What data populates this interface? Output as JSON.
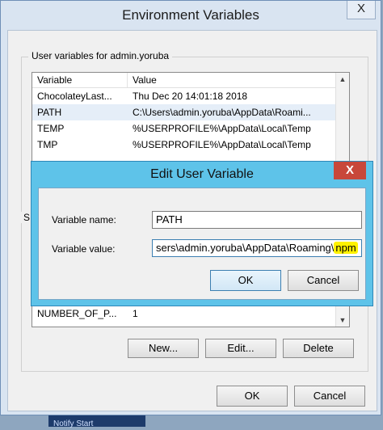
{
  "background": {
    "strip_text": "Notify  Start"
  },
  "outer": {
    "title": "Environment Variables",
    "close_glyph": "X",
    "user_group_label": "User variables for admin.yoruba",
    "columns": [
      "Variable",
      "Value"
    ],
    "user_rows": [
      {
        "variable": "ChocolateyLast...",
        "value": "Thu Dec 20 14:01:18 2018"
      },
      {
        "variable": "PATH",
        "value": "C:\\Users\\admin.yoruba\\AppData\\Roami..."
      },
      {
        "variable": "TEMP",
        "value": "%USERPROFILE%\\AppData\\Local\\Temp"
      },
      {
        "variable": "TMP",
        "value": "%USERPROFILE%\\AppData\\Local\\Temp"
      }
    ],
    "system_group_label": "S",
    "system_rows": [
      {
        "variable": "NUMBER_OF_P...",
        "value": "1"
      }
    ],
    "new_label": "New...",
    "edit_label": "Edit...",
    "delete_label": "Delete",
    "ok_label": "OK",
    "cancel_label": "Cancel"
  },
  "edit_dialog": {
    "title": "Edit User Variable",
    "close_glyph": "X",
    "name_label": "Variable name:",
    "name_value": "PATH",
    "value_label": "Variable value:",
    "value_prefix": "sers\\admin.yoruba\\AppData\\Roaming\\",
    "value_highlight": "npm",
    "ok_label": "OK",
    "cancel_label": "Cancel"
  }
}
